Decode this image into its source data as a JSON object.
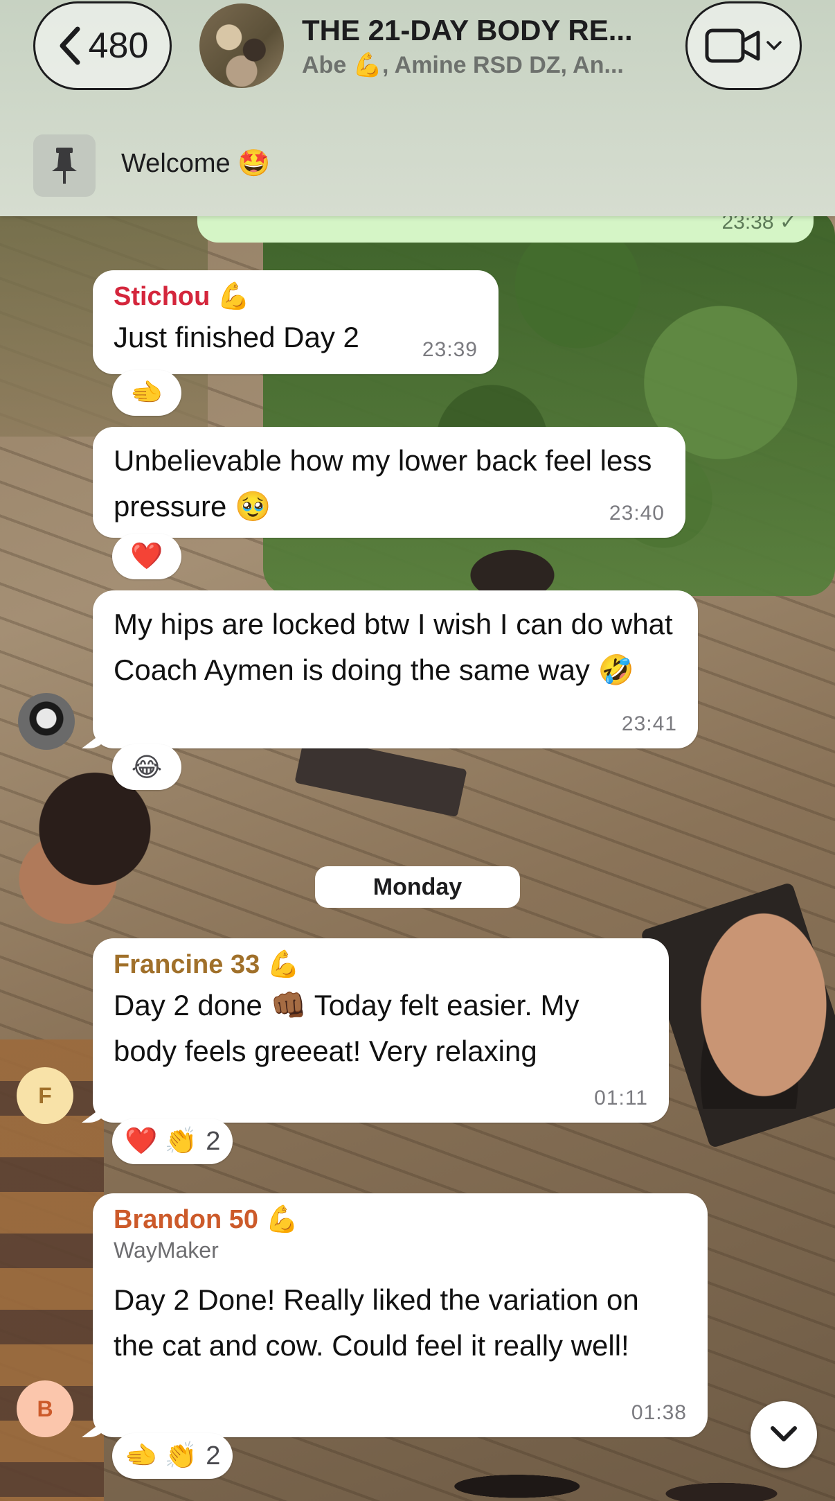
{
  "header": {
    "back_count": "480",
    "group_title": "THE 21-DAY BODY RE...",
    "group_members": "Abe 💪, Amine RSD DZ, An...",
    "pinned_text": "Welcome 🤩"
  },
  "own_message": {
    "time": "23:38 ✓"
  },
  "messages": [
    {
      "sender": "Stichou 💪",
      "sender_color": "#d4263c",
      "text": "Just finished Day 2",
      "time": "23:39",
      "reactions": {
        "emoji": "🫲",
        "count": ""
      }
    },
    {
      "text": "Unbelievable how my lower back feel less pressure 🥹",
      "time": "23:40",
      "reactions": {
        "emoji": "❤️",
        "count": ""
      }
    },
    {
      "text": "My hips are locked btw I wish I can do what Coach Aymen is doing the same way 🤣",
      "time": "23:41",
      "reactions": {
        "emoji": "😂",
        "count": ""
      }
    },
    {
      "sender": "Francine 33 💪",
      "sender_color": "#a0702a",
      "text": "Day 2 done 👊🏾 Today felt easier. My body feels greeeat! Very relaxing",
      "time": "01:11",
      "avatar_letter": "F",
      "reactions": {
        "emoji": "❤️ 👏",
        "count": "2"
      }
    },
    {
      "sender": "Brandon 50 💪",
      "sender_color": "#cc5a2a",
      "sender_sub": "WayMaker",
      "text": "Day 2 Done!  Really liked the variation on the cat and cow.  Could feel it really well!",
      "time": "01:38",
      "avatar_letter": "B",
      "reactions": {
        "emoji": "🫲 👏",
        "count": "2"
      }
    }
  ],
  "day_divider": "Monday",
  "colors": {
    "header_bg": "#d3dacf",
    "own_bubble": "#d5f5c6",
    "avatar_f_bg": "#f8e2a8",
    "avatar_b_bg": "#fbc6ac"
  }
}
